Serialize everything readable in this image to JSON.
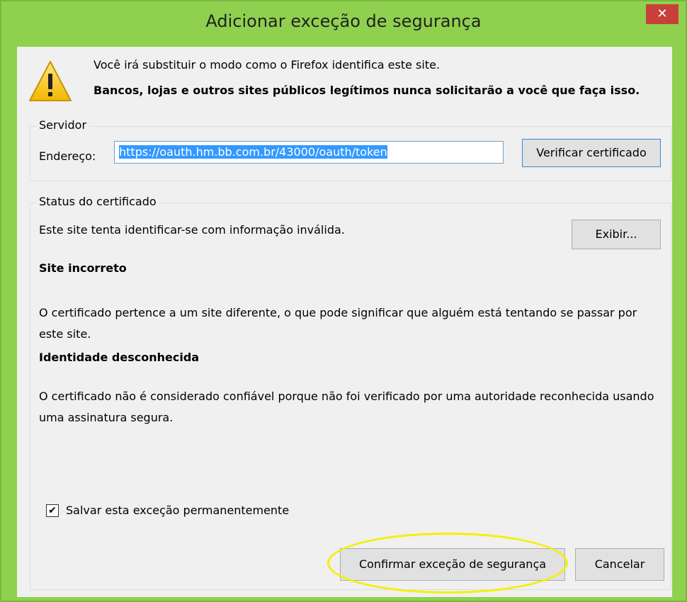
{
  "window": {
    "title": "Adicionar exceção de segurança",
    "close_symbol": "✕",
    "accent": "#8fd14f"
  },
  "message": {
    "line1": "Você irá substituir o modo como o Firefox identifica este site.",
    "line2": "Bancos, lojas e outros sites públicos legítimos nunca solicitarão a você que faça isso."
  },
  "server": {
    "group_label": "Servidor",
    "address_label": "Endereço:",
    "address_value": "https://oauth.hm.bb.com.br/43000/oauth/token",
    "verify_button": "Verificar certificado"
  },
  "status": {
    "group_label": "Status do certificado",
    "summary": "Este site tenta identificar-se com informação inválida.",
    "view_button": "Exibir...",
    "wrong_site_heading": "Site incorreto",
    "wrong_site_text": "O certificado pertence a um site diferente, o que pode significar que alguém está tentando se passar por este site.",
    "unknown_identity_heading": "Identidade desconhecida",
    "unknown_identity_text": "O certificado não é considerado confiável porque não foi verificado por uma autoridade reconhecida usando uma assinatura segura."
  },
  "options": {
    "save_permanently_label": "Salvar esta exceção permanentemente",
    "save_permanently_checked": true
  },
  "buttons": {
    "confirm": "Confirmar exceção de segurança",
    "cancel": "Cancelar"
  },
  "annotation": {
    "highlight_color": "#f4f000"
  }
}
